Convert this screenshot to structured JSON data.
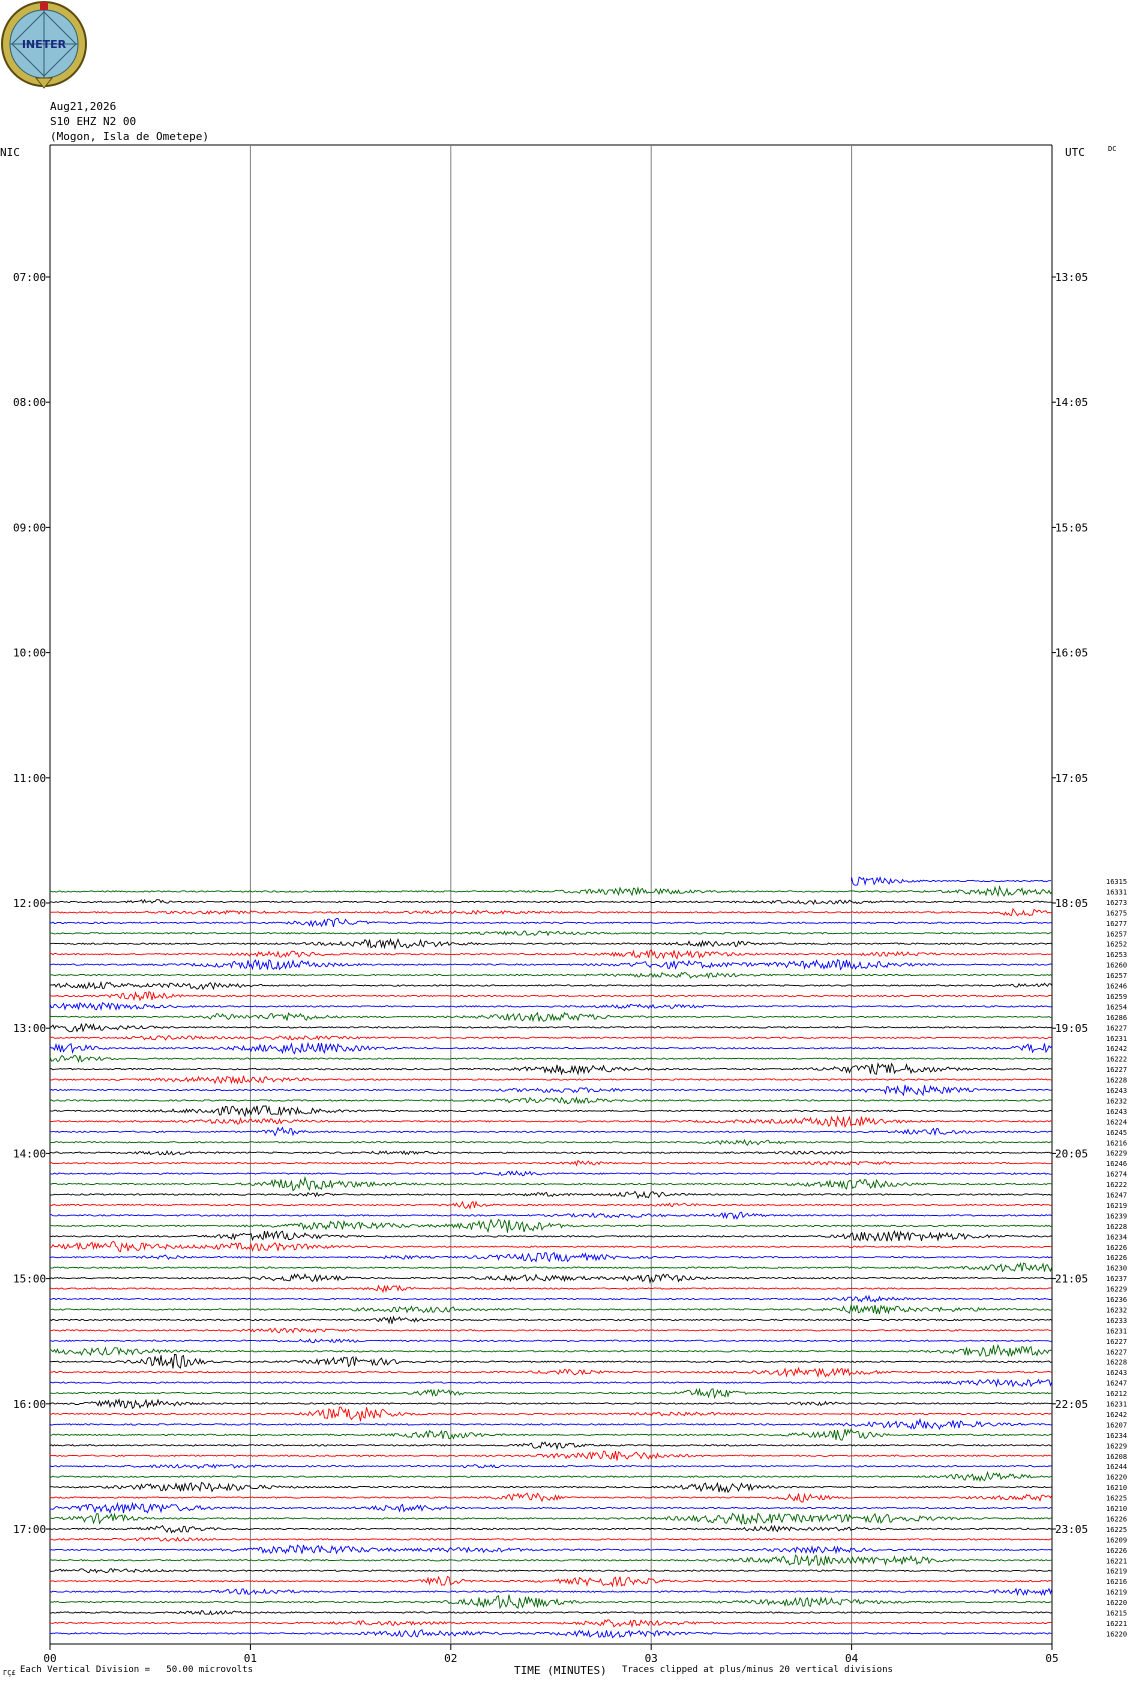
{
  "logo": {
    "text": "INETER"
  },
  "header": {
    "date": "Aug21,2026",
    "station": "S10 EHZ N2 00",
    "location": "(Mogon, Isla de Ometepe)"
  },
  "left_zone": "NIC",
  "right_zone": "UTC",
  "dc_label": "DC",
  "footer": {
    "scale": "Each Vertical Division =   50.00 microvolts",
    "clip": "Traces clipped at plus/minus 20 vertical divisions",
    "corner_mark": "ΓÇ£"
  },
  "colors": {
    "black": "#000000",
    "red": "#ff0000",
    "blue": "#0000ff",
    "green": "#006400",
    "grid": "#808080"
  },
  "chart_data": {
    "type": "line",
    "title": "",
    "xlabel": "TIME (MINUTES)",
    "ylabel": "",
    "xlim": [
      0,
      5
    ],
    "x_ticks": [
      "00",
      "01",
      "02",
      "03",
      "04",
      "05"
    ],
    "y_ticks_left": [
      "07:00",
      "08:00",
      "09:00",
      "10:00",
      "11:00",
      "12:00",
      "13:00",
      "14:00",
      "15:00",
      "16:00",
      "17:00"
    ],
    "y_ticks_right": [
      "13:05",
      "14:05",
      "15:05",
      "16:05",
      "17:05",
      "18:05",
      "19:05",
      "20:05",
      "21:05",
      "22:05",
      "23:05"
    ],
    "trace_color_cycle": [
      "blue",
      "green",
      "black",
      "red"
    ],
    "traces": [
      {
        "start_min": 4.0,
        "dc": "16315"
      },
      {
        "dc": "16331"
      },
      {
        "dc": "16273"
      },
      {
        "dc": "16275"
      },
      {
        "dc": "16277"
      },
      {
        "dc": "16257"
      },
      {
        "dc": "16252"
      },
      {
        "dc": "16253"
      },
      {
        "dc": "16260"
      },
      {
        "dc": "16257"
      },
      {
        "dc": "16246"
      },
      {
        "dc": "16259"
      },
      {
        "dc": "16254"
      },
      {
        "dc": "16286"
      },
      {
        "dc": "16227"
      },
      {
        "dc": "16231"
      },
      {
        "dc": "16242"
      },
      {
        "dc": "16222"
      },
      {
        "dc": "16227"
      },
      {
        "dc": "16228"
      },
      {
        "dc": "16243"
      },
      {
        "dc": "16232"
      },
      {
        "dc": "16243"
      },
      {
        "dc": "16224"
      },
      {
        "dc": "16245"
      },
      {
        "dc": "16216"
      },
      {
        "dc": "16229"
      },
      {
        "dc": "16246"
      },
      {
        "dc": "16274"
      },
      {
        "dc": "16222"
      },
      {
        "dc": "16247"
      },
      {
        "dc": "16219"
      },
      {
        "dc": "16239"
      },
      {
        "dc": "16228"
      },
      {
        "dc": "16234"
      },
      {
        "dc": "16226"
      },
      {
        "dc": "16226"
      },
      {
        "dc": "16230"
      },
      {
        "dc": "16237"
      },
      {
        "dc": "16229"
      },
      {
        "dc": "16236"
      },
      {
        "dc": "16232"
      },
      {
        "dc": "16233"
      },
      {
        "dc": "16231"
      },
      {
        "dc": "16227"
      },
      {
        "dc": "16227"
      },
      {
        "dc": "16228"
      },
      {
        "dc": "16243"
      },
      {
        "dc": "16247"
      },
      {
        "dc": "16212"
      },
      {
        "dc": "16231"
      },
      {
        "dc": "16242"
      },
      {
        "dc": "16207"
      },
      {
        "dc": "16234"
      },
      {
        "dc": "16229"
      },
      {
        "dc": "16208"
      },
      {
        "dc": "16244"
      },
      {
        "dc": "16220"
      },
      {
        "dc": "16210"
      },
      {
        "dc": "16225"
      },
      {
        "dc": "16210"
      },
      {
        "dc": "16226"
      },
      {
        "dc": "16225"
      },
      {
        "dc": "16209"
      },
      {
        "dc": "16226"
      },
      {
        "dc": "16221"
      },
      {
        "dc": "16219"
      },
      {
        "dc": "16216"
      },
      {
        "dc": "16219"
      },
      {
        "dc": "16220"
      },
      {
        "dc": "16215"
      },
      {
        "dc": "16221"
      },
      {
        "dc": "16220"
      }
    ]
  }
}
